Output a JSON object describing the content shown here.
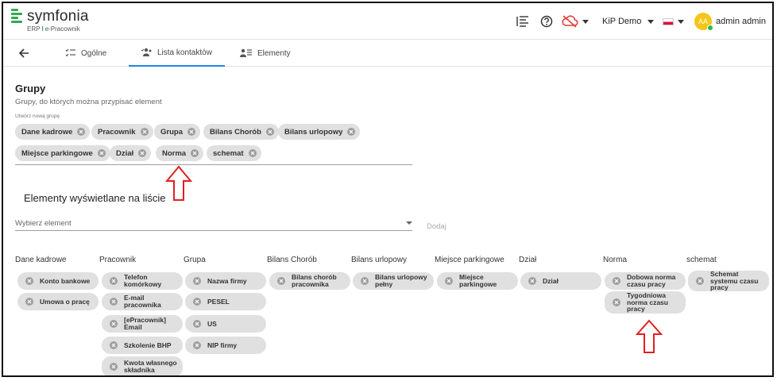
{
  "app": {
    "name": "symfonia",
    "subtitle_left": "ERP",
    "subtitle_right": "e-Pracownik"
  },
  "topbar": {
    "icons": [
      "list-icon",
      "help-icon",
      "cloud-off-icon"
    ],
    "company": "KiP Demo",
    "user_initials": "AA",
    "user_name": "admin admin"
  },
  "tabs": [
    {
      "label": "Ogólne",
      "icon": "list-check-icon",
      "active": false
    },
    {
      "label": "Lista kontaktów",
      "icon": "contacts-icon",
      "active": true
    },
    {
      "label": "Elementy",
      "icon": "person-list-icon",
      "active": false
    }
  ],
  "groups": {
    "title": "Grupy",
    "subtitle": "Grupy, do których można przypisać element",
    "new_group_label": "Utwórz nową grupę",
    "chips": [
      "Dane kadrowe",
      "Pracownik",
      "Grupa",
      "Bilans Chorób",
      "Bilans urlopowy",
      "Miejsce parkingowe",
      "Dział",
      "Norma",
      "schemat"
    ]
  },
  "elements": {
    "title": "Elementy wyświetlane na liście",
    "select_placeholder": "Wybierz element",
    "add_label": "Dodaj"
  },
  "columns": [
    {
      "header": "Dane kadrowe",
      "items": [
        "Konto bankowe",
        "Umowa o pracę"
      ]
    },
    {
      "header": "Pracownik",
      "items": [
        "Telefon komórkowy",
        "E-mail pracownika",
        "[ePracownik] Email",
        "Szkolenie BHP",
        "Kwota własnego składnika"
      ]
    },
    {
      "header": "Grupa",
      "items": [
        "Nazwa firmy",
        "PESEL",
        "US",
        "NIP firmy"
      ]
    },
    {
      "header": "Bilans Chorób",
      "items": [
        "Bilans chorób pracownika"
      ]
    },
    {
      "header": "Bilans urlopowy",
      "items": [
        "Bilans urlopowy pełny"
      ]
    },
    {
      "header": "Miejsce parkingowe",
      "items": [
        "Miejsce parkingowe"
      ]
    },
    {
      "header": "Dział",
      "items": [
        "Dział"
      ]
    },
    {
      "header": "Norma",
      "items": [
        "Dobowa norma czasu pracy",
        "Tygodniowa norma czasu pracy"
      ]
    },
    {
      "header": "schemat",
      "items": [
        "Schemat systemu czasu pracy"
      ]
    }
  ],
  "colors": {
    "accent": "#1e88e5",
    "chip": "#e0e0e0",
    "logo_green": "#34a853",
    "annotation_red": "#e02020",
    "avatar": "#f5c518"
  }
}
